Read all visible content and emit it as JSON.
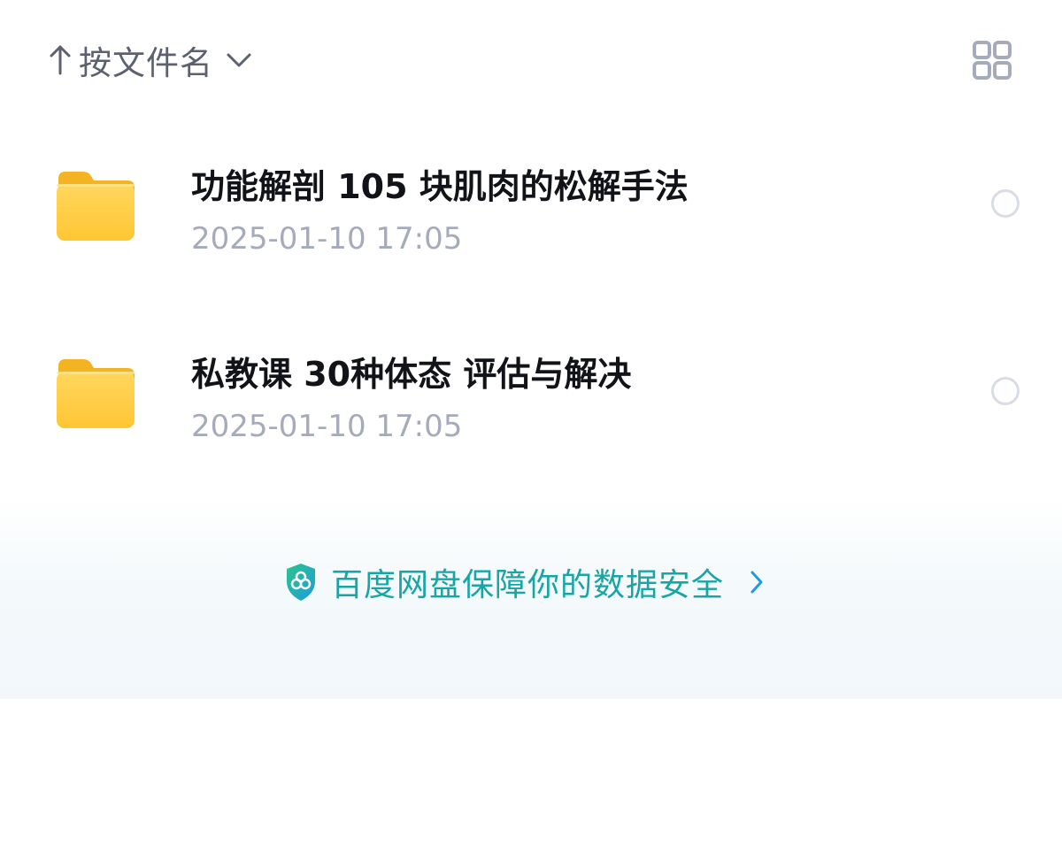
{
  "toolbar": {
    "sort_label": "按文件名",
    "sort_icon": "arrow-up-icon",
    "dropdown_icon": "chevron-down-icon",
    "view_toggle_icon": "grid-view-icon"
  },
  "files": [
    {
      "name": "功能解剖 105 块肌肉的松解手法",
      "modified": "2025-01-10 17:05",
      "icon": "folder-icon"
    },
    {
      "name": "私教课 30种体态 评估与解决",
      "modified": "2025-01-10 17:05",
      "icon": "folder-icon"
    }
  ],
  "security_banner": {
    "text": "百度网盘保障你的数据安全",
    "icon": "shield-icon",
    "chevron": "chevron-right-icon"
  },
  "colors": {
    "folder": "#FFC93C",
    "accent": "#18A5A6",
    "muted_text": "#A5ABBB",
    "primary_text": "#111318"
  }
}
